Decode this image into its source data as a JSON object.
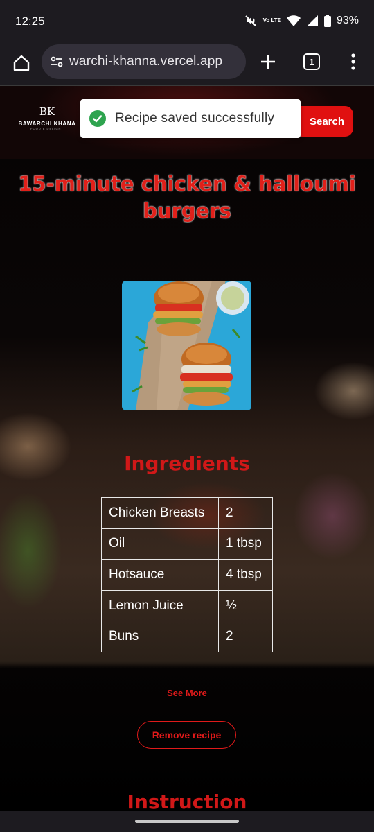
{
  "status_bar": {
    "time": "12:25",
    "network_label": "Vo LTE",
    "battery": "93%",
    "icons": [
      "mute-icon",
      "volte-icon",
      "wifi-icon",
      "signal-icon",
      "battery-icon"
    ]
  },
  "browser": {
    "url": "warchi-khanna.vercel.app",
    "tab_count": "1",
    "icons": [
      "home-icon",
      "site-settings-icon",
      "new-tab-icon",
      "tab-switcher-icon",
      "more-menu-icon"
    ]
  },
  "header": {
    "logo_mark": "BK",
    "logo_name": "BAWARCHI KHANA",
    "logo_tagline": "FOODIE DELIGHT",
    "search_label": "Search"
  },
  "toast": {
    "message": "Recipe saved successfully",
    "icon": "check-circle-icon",
    "color": "#2ea44f"
  },
  "recipe": {
    "title": "15-minute chicken & halloumi burgers",
    "image": "burger-photo"
  },
  "ingredients": {
    "heading": "Ingredients",
    "rows": [
      {
        "name": "Chicken Breasts",
        "qty": "2"
      },
      {
        "name": "Oil",
        "qty": "1 tbsp"
      },
      {
        "name": "Hotsauce",
        "qty": "4 tbsp"
      },
      {
        "name": "Lemon Juice",
        "qty": "½"
      },
      {
        "name": "Buns",
        "qty": "2"
      }
    ]
  },
  "actions": {
    "see_more": "See More",
    "remove_recipe": "Remove recipe"
  },
  "instructions": {
    "heading": "Instruction"
  },
  "colors": {
    "accent": "#e01010",
    "heading_red": "#d01818",
    "chrome_bg": "#1d1b20"
  }
}
